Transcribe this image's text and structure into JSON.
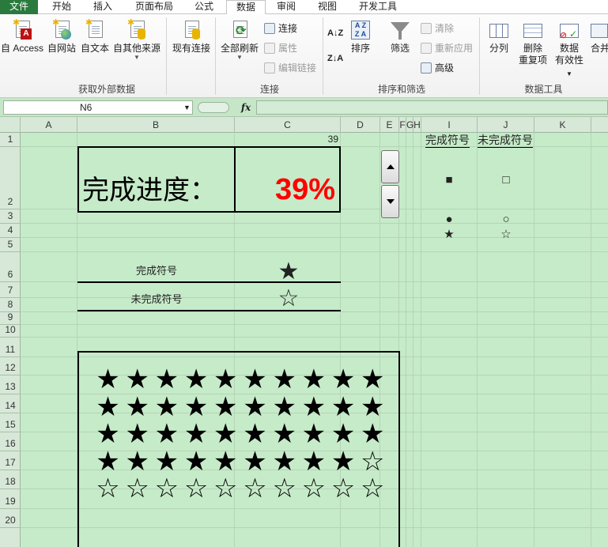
{
  "tabs": [
    {
      "label": "文件"
    },
    {
      "label": "开始"
    },
    {
      "label": "插入"
    },
    {
      "label": "页面布局"
    },
    {
      "label": "公式"
    },
    {
      "label": "数据"
    },
    {
      "label": "审阅"
    },
    {
      "label": "视图"
    },
    {
      "label": "开发工具"
    }
  ],
  "ribbon": {
    "get_external": {
      "access": "自 Access",
      "web": "自网站",
      "text": "自文本",
      "other": "自其他来源",
      "existing": "现有连接",
      "group_label": "获取外部数据"
    },
    "connections": {
      "refresh_all": "全部刷新",
      "connections": "连接",
      "properties": "属性",
      "edit_links": "编辑链接",
      "group_label": "连接"
    },
    "sort_filter": {
      "sort": "排序",
      "filter": "筛选",
      "clear": "清除",
      "reapply": "重新应用",
      "advanced": "高级",
      "group_label": "排序和筛选"
    },
    "data_tools": {
      "split": "分列",
      "remove_dup_1": "删除",
      "remove_dup_2": "重复项",
      "validation_1": "数据",
      "validation_2": "有效性",
      "merge": "合并",
      "group_label": "数据工具"
    }
  },
  "formula_bar": {
    "name_box": "N6",
    "fx": "fx",
    "formula": ""
  },
  "sheet": {
    "columns": [
      "A",
      "B",
      "C",
      "D",
      "E",
      "F",
      "G",
      "H",
      "I",
      "J",
      "K"
    ],
    "rows": [
      "1",
      "2",
      "3",
      "4",
      "5",
      "6",
      "7",
      "8",
      "9",
      "10",
      "11",
      "12",
      "13",
      "14",
      "15",
      "16",
      "17",
      "18",
      "19",
      "20"
    ],
    "c1_value": "39",
    "progress_label": "完成进度：",
    "progress_pct": "39%",
    "legend": {
      "done_label": "完成符号",
      "done_symbol": "★",
      "undone_label": "未完成符号",
      "undone_symbol": "☆"
    },
    "symbol_table": {
      "header_done": "完成符号",
      "header_undone": "未完成符号",
      "pairs": [
        {
          "done": "■",
          "undone": "□"
        },
        {
          "done": "●",
          "undone": "○"
        },
        {
          "done": "★",
          "undone": "☆"
        }
      ]
    },
    "star_grid": {
      "total": 50,
      "completed": 39,
      "columns": 10,
      "filled_symbol": "★",
      "empty_symbol": "☆"
    }
  },
  "colors": {
    "sheet_bg": "#c6ebc9",
    "file_tab": "#2a7a3e",
    "progress_pct": "#ff0000"
  }
}
